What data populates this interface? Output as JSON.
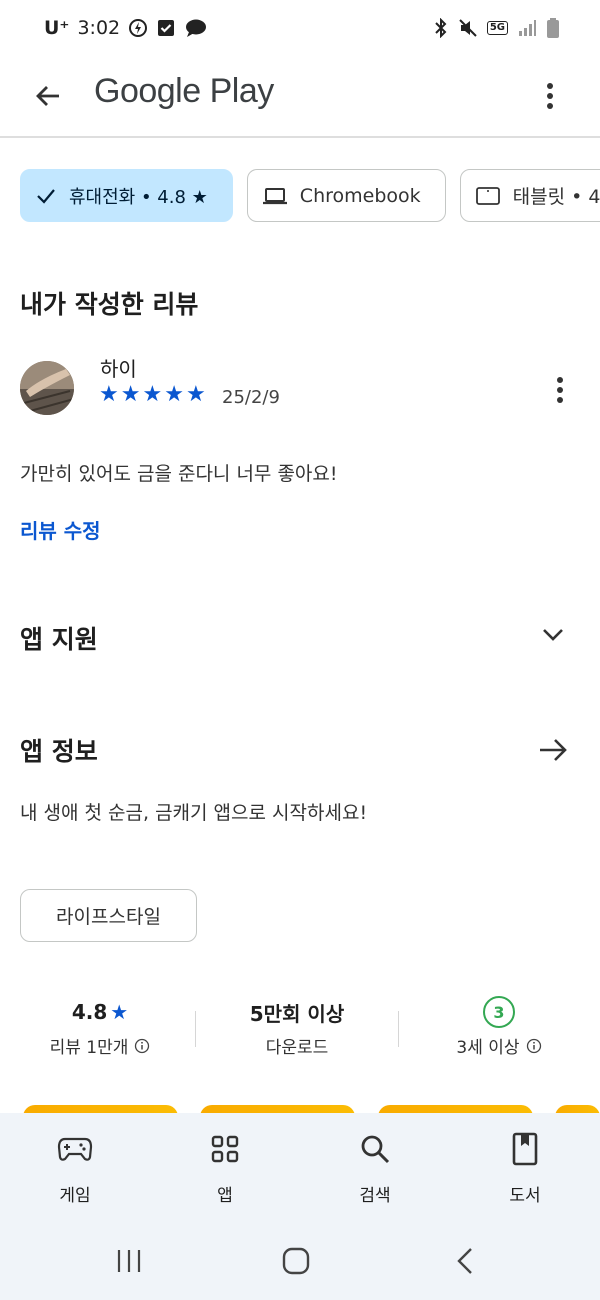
{
  "status_bar": {
    "carrier": "U⁺",
    "time": "3:02",
    "network": "5G"
  },
  "app_bar": {
    "title": "Google Play"
  },
  "device_chips": [
    {
      "label": "휴대전화 • 4.8 ★",
      "icon": "check-icon",
      "selected": true
    },
    {
      "label": "Chromebook",
      "icon": "laptop-icon",
      "selected": false
    },
    {
      "label": "태블릿 • 4",
      "icon": "tablet-icon",
      "selected": false
    }
  ],
  "my_review": {
    "section_title": "내가 작성한 리뷰",
    "author": "하이",
    "stars": 5,
    "date": "25/2/9",
    "text": "가만히 있어도 금을 준다니 너무 좋아요!",
    "edit_label": "리뷰 수정"
  },
  "app_support": {
    "title": "앱 지원"
  },
  "app_info": {
    "title": "앱 정보",
    "description": "내 생애 첫 순금, 금캐기 앱으로 시작하세요!",
    "category": "라이프스타일"
  },
  "stats": {
    "rating_value": "4.8",
    "rating_label": "리뷰 1만개",
    "downloads_value": "5만회 이상",
    "downloads_label": "다운로드",
    "age_value": "3",
    "age_label": "3세 이상"
  },
  "bottom_nav": [
    {
      "label": "게임",
      "icon": "gamepad-icon"
    },
    {
      "label": "앱",
      "icon": "apps-grid-icon"
    },
    {
      "label": "검색",
      "icon": "search-icon"
    },
    {
      "label": "도서",
      "icon": "book-icon"
    }
  ],
  "colors": {
    "accent_blue": "#0b57d0",
    "chip_selected_bg": "#c2e7ff",
    "age_badge_green": "#34a853",
    "nav_bg": "#f0f4f9"
  }
}
